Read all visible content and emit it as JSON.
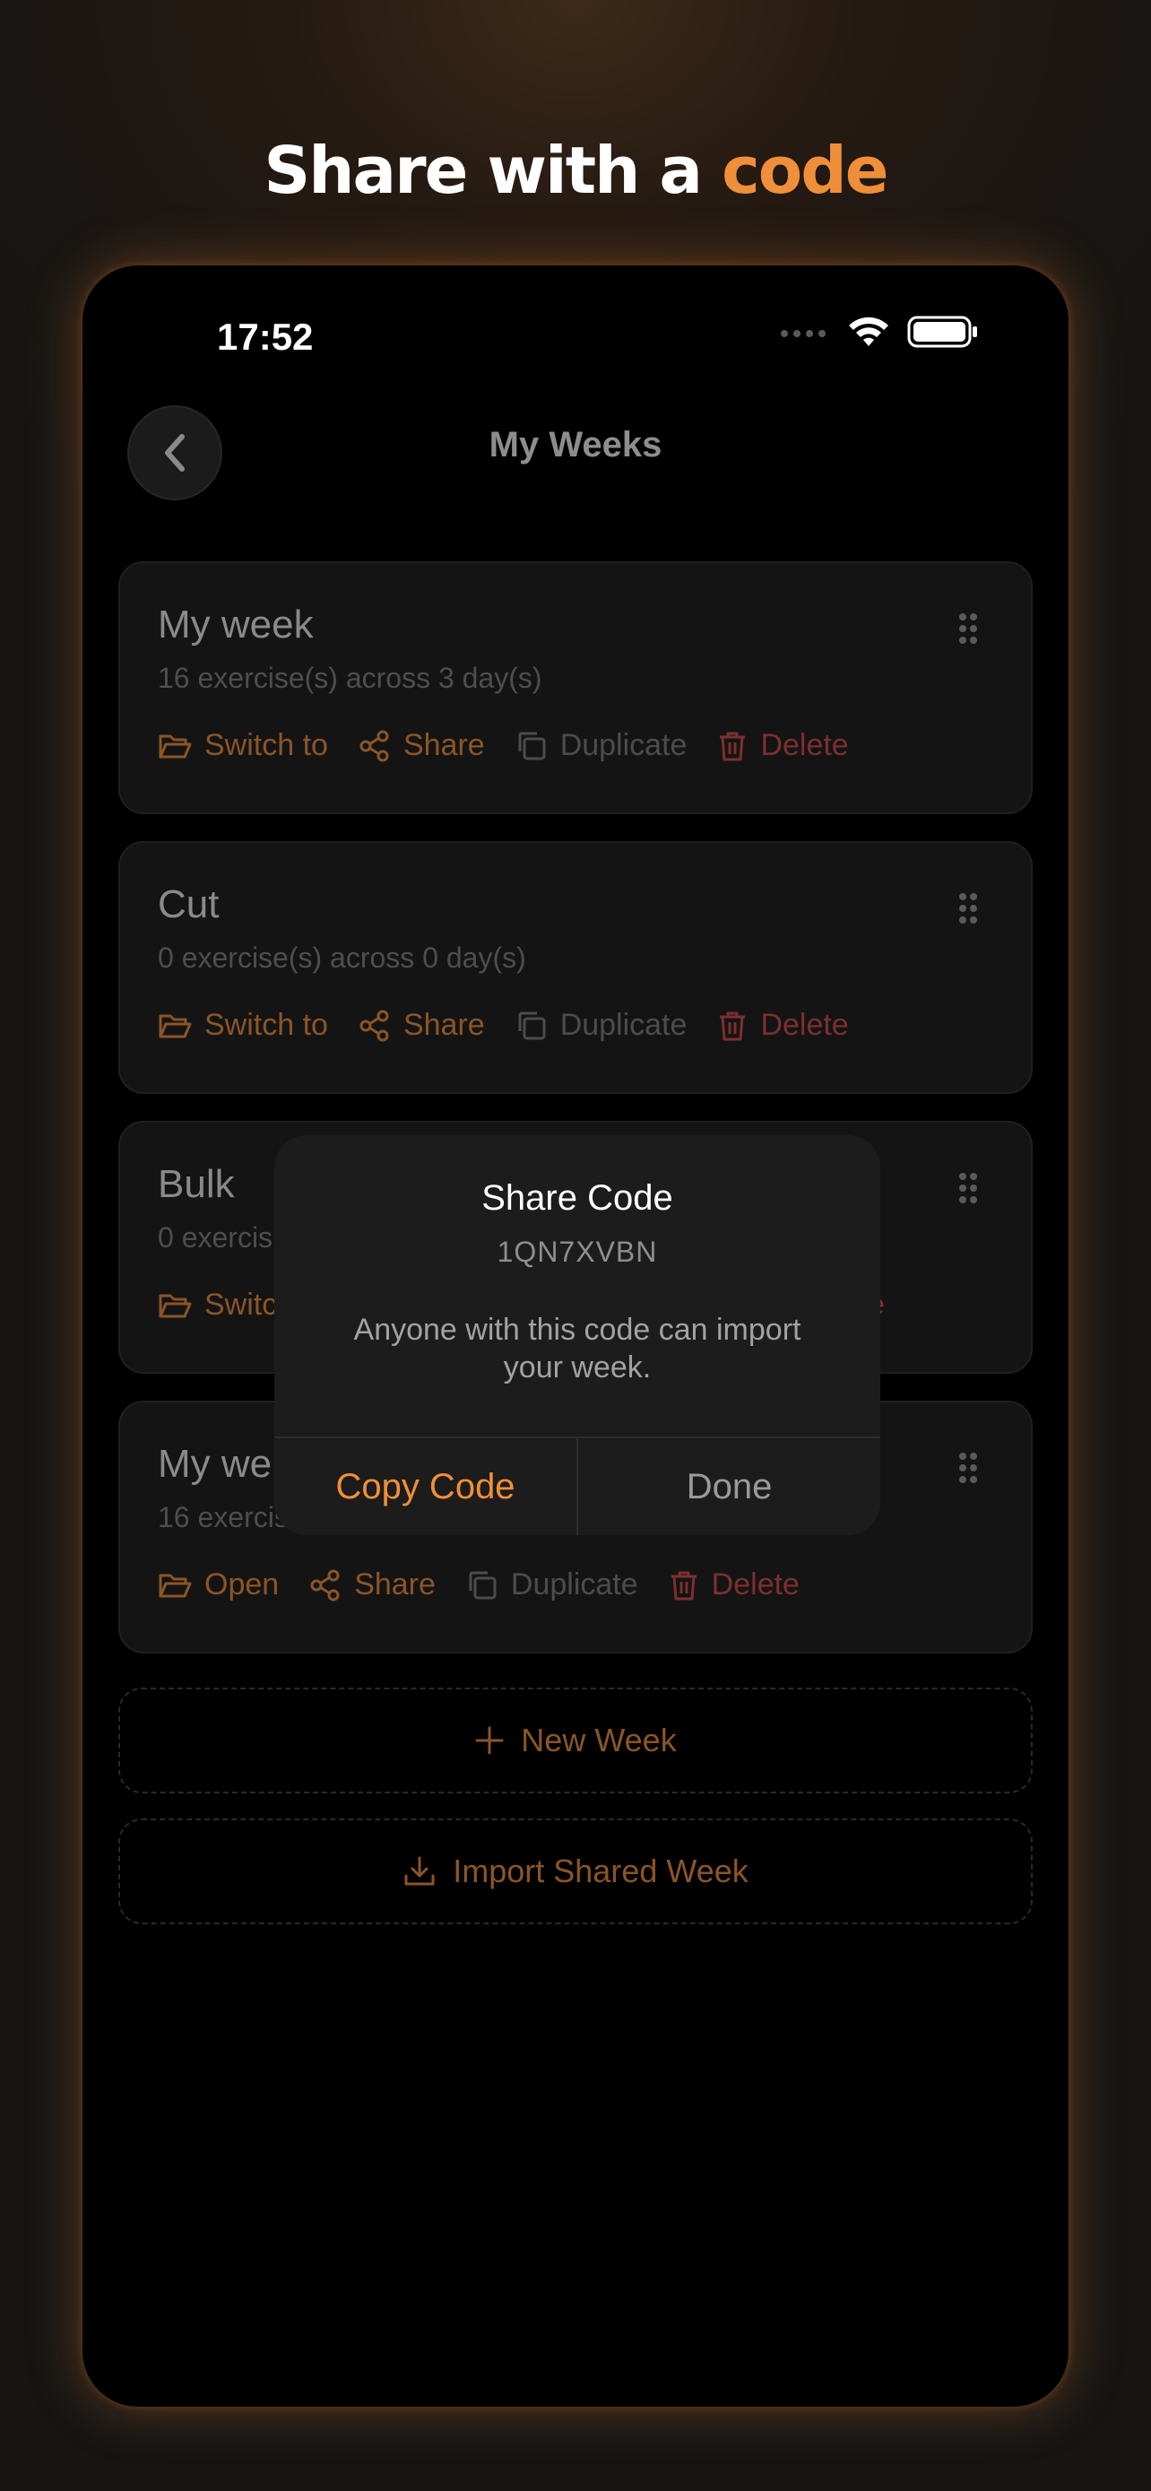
{
  "headline": {
    "part1": "Share with a ",
    "part2": "code"
  },
  "status_bar": {
    "time": "17:52"
  },
  "nav": {
    "title": "My Weeks"
  },
  "cards": [
    {
      "title": "My week",
      "subtitle": "16 exercise(s) across 3 day(s)",
      "primary_action": "Switch to",
      "share": "Share",
      "duplicate": "Duplicate",
      "delete": "Delete"
    },
    {
      "title": "Cut",
      "subtitle": "0 exercise(s) across 0 day(s)",
      "primary_action": "Switch to",
      "share": "Share",
      "duplicate": "Duplicate",
      "delete": "Delete"
    },
    {
      "title": "Bulk",
      "subtitle": "0 exercis",
      "primary_action": "Switc",
      "share": "",
      "duplicate": "",
      "delete": "e"
    },
    {
      "title": "My we",
      "subtitle": "16 exercis",
      "primary_action": "Open",
      "share": "Share",
      "duplicate": "Duplicate",
      "delete": "Delete"
    }
  ],
  "new_week": "New Week",
  "import_week": "Import Shared Week",
  "dialog": {
    "title": "Share Code",
    "code": "1QN7XVBN",
    "message": "Anyone with this code can import your week.",
    "copy_label": "Copy Code",
    "done_label": "Done"
  },
  "colors": {
    "accent": "#ef8f3a",
    "danger": "#b84444",
    "background": "#000000"
  }
}
